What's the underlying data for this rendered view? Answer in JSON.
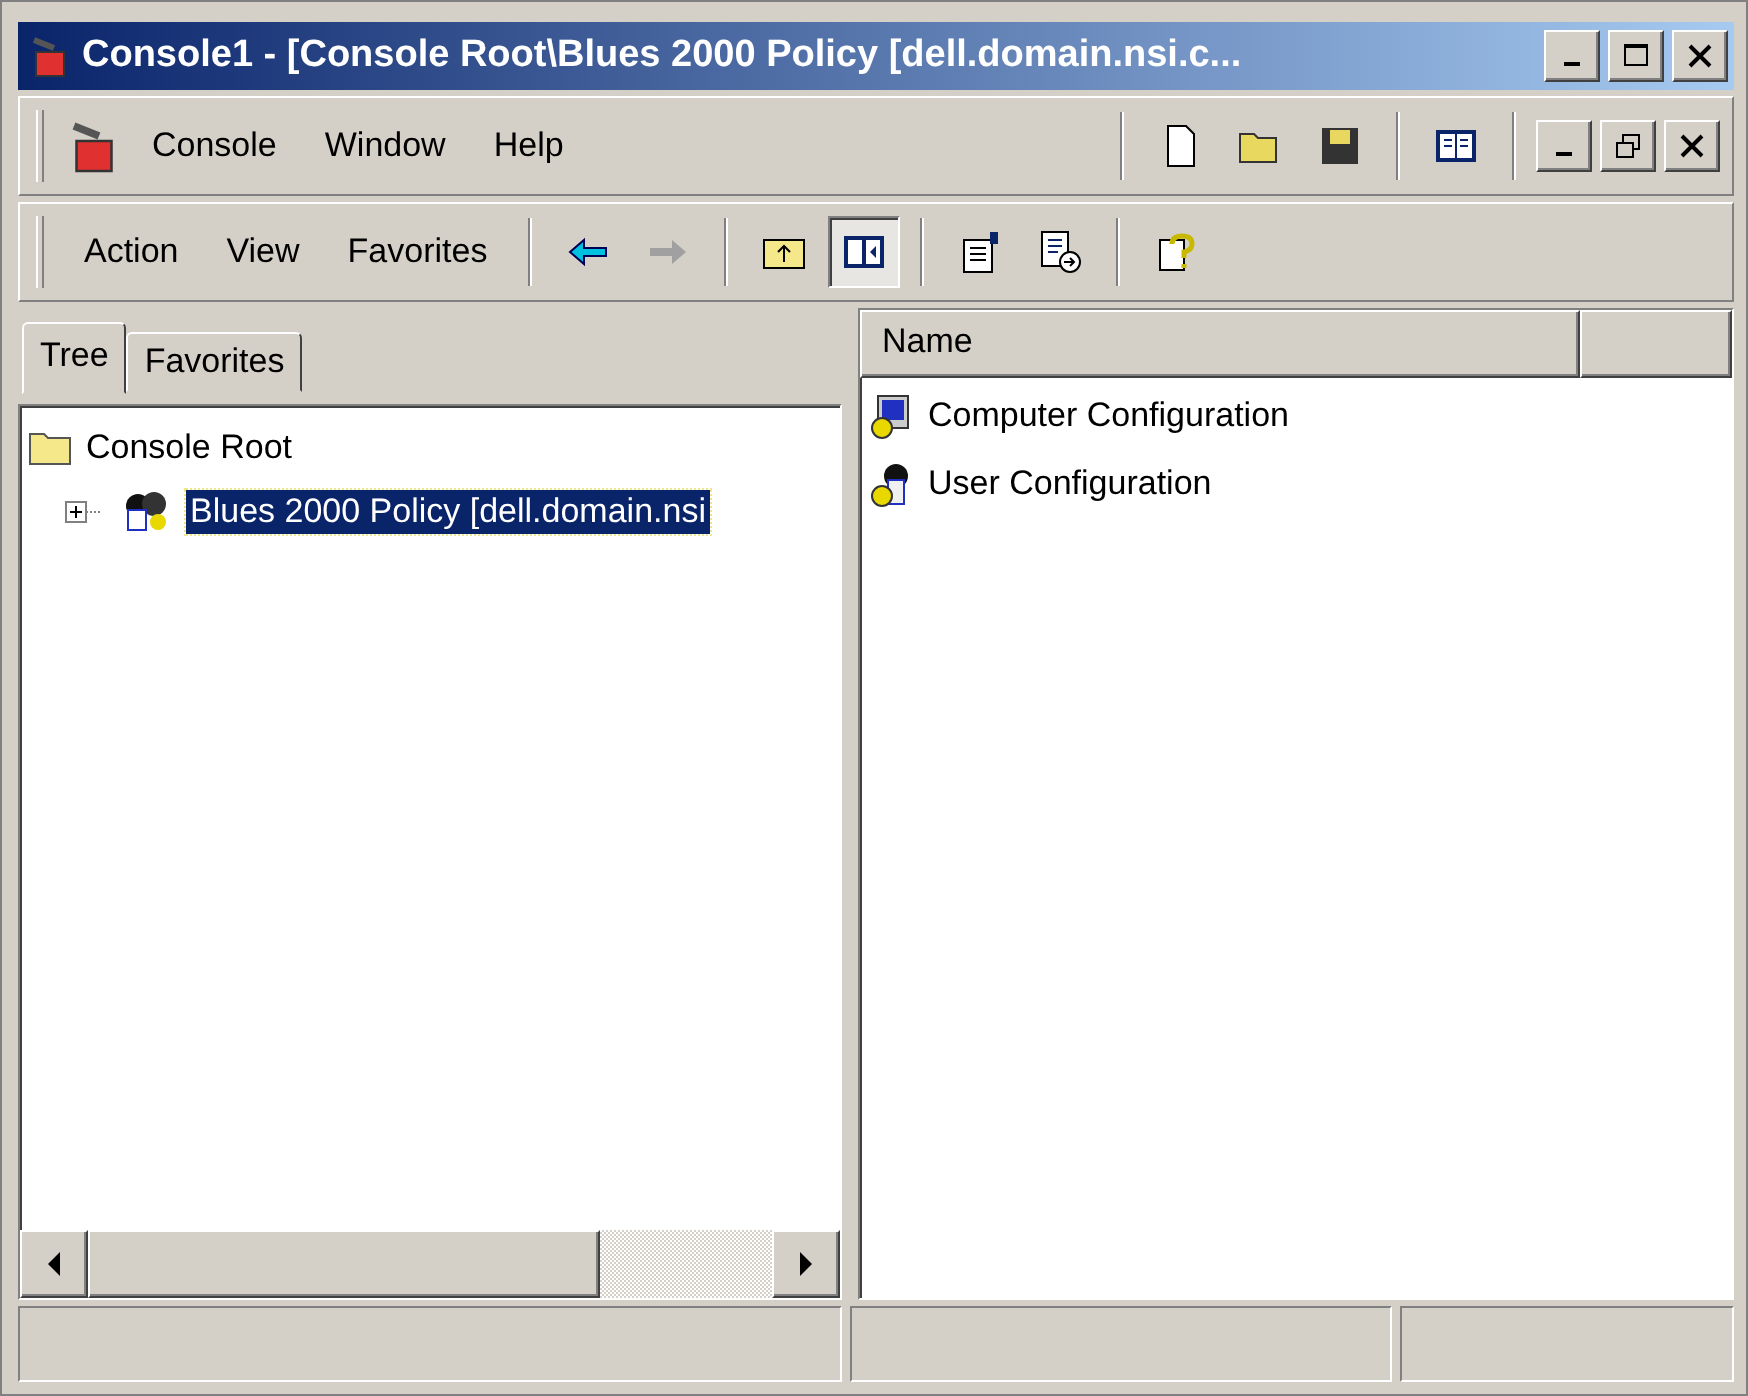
{
  "window": {
    "title": "Console1 - [Console Root\\Blues 2000 Policy [dell.domain.nsi.c..."
  },
  "menu_bar": {
    "items": [
      "Console",
      "Window",
      "Help"
    ]
  },
  "action_bar": {
    "items": [
      "Action",
      "View",
      "Favorites"
    ]
  },
  "left_pane": {
    "tabs": [
      {
        "label": "Tree",
        "selected": true
      },
      {
        "label": "Favorites",
        "selected": false
      }
    ],
    "tree": [
      {
        "label": "Console Root",
        "kind": "folder",
        "children": [
          {
            "label": "Blues 2000 Policy [dell.domain.nsi",
            "kind": "policy",
            "selected": true,
            "expanded": false
          }
        ]
      }
    ]
  },
  "right_pane": {
    "columns": [
      "Name"
    ],
    "rows": [
      {
        "label": "Computer Configuration",
        "kind": "computer"
      },
      {
        "label": "User Configuration",
        "kind": "user"
      }
    ]
  }
}
